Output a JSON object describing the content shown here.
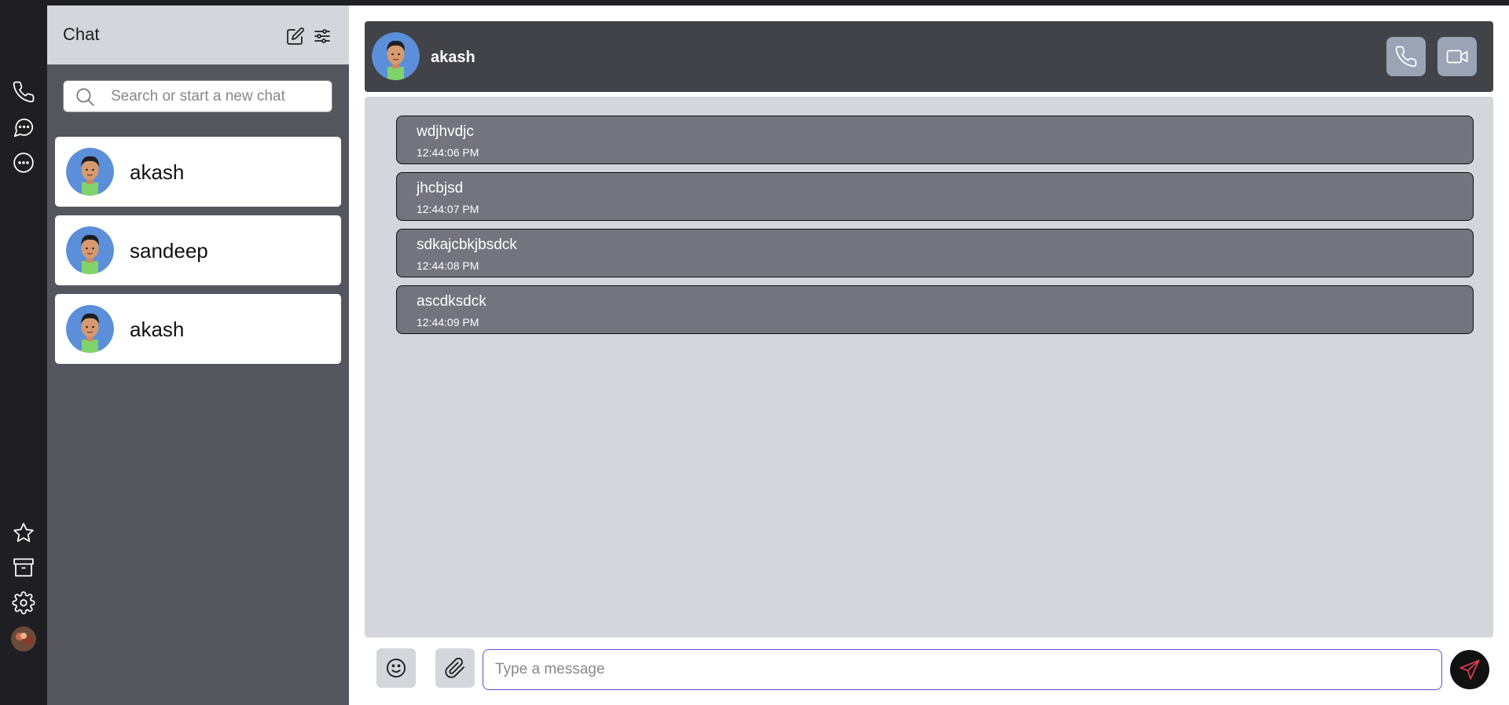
{
  "rail": {
    "top_icons": [
      "phone-icon",
      "chat-bubble-icon",
      "more-dots-icon"
    ],
    "bottom_icons": [
      "star-icon",
      "archive-icon",
      "settings-gear-icon"
    ]
  },
  "panel": {
    "title": "Chat",
    "icons": [
      "edit-icon",
      "filter-sliders-icon"
    ],
    "search_placeholder": "Search or start a new chat",
    "contacts": [
      {
        "name": "akash"
      },
      {
        "name": "sandeep"
      },
      {
        "name": "akash"
      }
    ]
  },
  "chat": {
    "contact_name": "akash",
    "header_icons": [
      "voice-call-icon",
      "video-call-icon"
    ],
    "messages": [
      {
        "text": "wdjhvdjc",
        "time": "12:44:06 PM"
      },
      {
        "text": "jhcbjsd",
        "time": "12:44:07 PM"
      },
      {
        "text": "sdkajcbkjbsdck",
        "time": "12:44:08 PM"
      },
      {
        "text": "ascdksdck",
        "time": "12:44:09 PM"
      }
    ],
    "input_placeholder": "Type a message",
    "composer_icons": [
      "emoji-icon",
      "attach-paperclip-icon",
      "send-icon"
    ]
  },
  "colors": {
    "rail_bg": "#1f1f23",
    "panel_bg": "#55565d",
    "panel_head_bg": "#d3d6db",
    "chat_header_bg": "#424249",
    "message_bg": "#73747d",
    "messages_area_bg": "#d3d6db",
    "input_border": "#5b4dd8",
    "send_icon": "#e23a53"
  }
}
